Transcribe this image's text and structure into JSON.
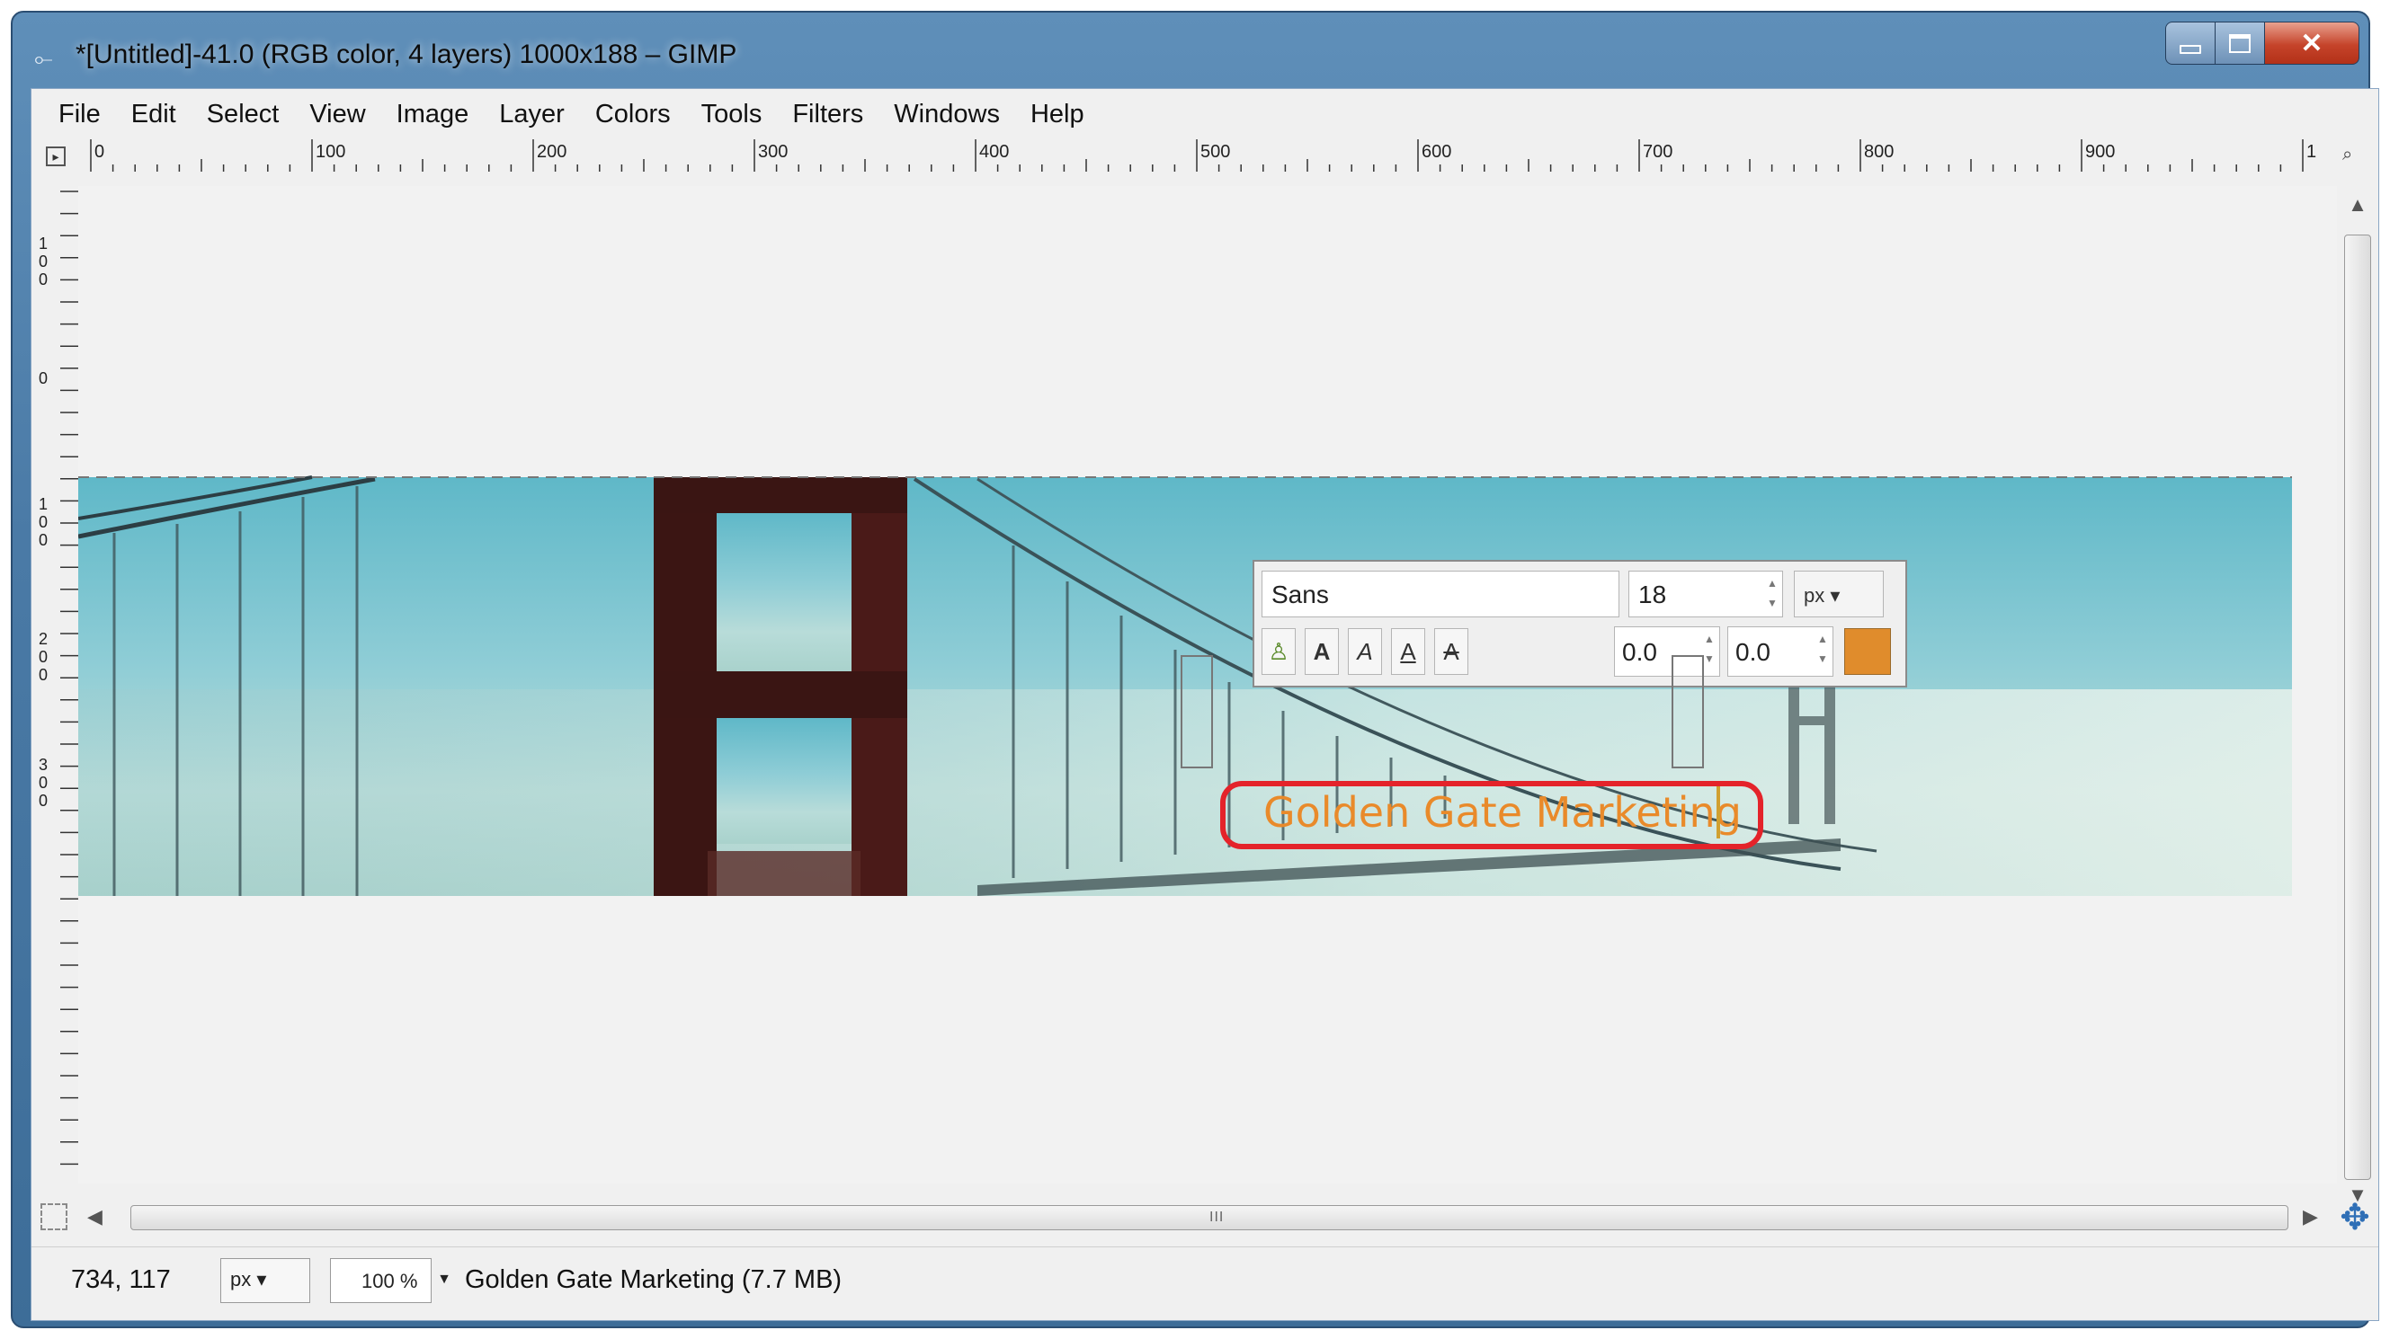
{
  "window": {
    "title": "*[Untitled]-41.0 (RGB color, 4 layers) 1000x188 – GIMP",
    "controls": {
      "minimize": "",
      "maximize": "",
      "close": "✕"
    }
  },
  "menu": [
    "File",
    "Edit",
    "Select",
    "View",
    "Image",
    "Layer",
    "Colors",
    "Tools",
    "Filters",
    "Windows",
    "Help"
  ],
  "ruler": {
    "horizontal_labels": [
      "0",
      "100",
      "200",
      "300",
      "400",
      "500",
      "600",
      "700",
      "800",
      "900",
      "1"
    ],
    "vertical_labels": [
      "1\n0\n0",
      "0",
      "1\n0\n0",
      "2\n0\n0",
      "3\n0\n0"
    ]
  },
  "text_tool": {
    "font": "Sans",
    "size": "18",
    "unit": "px",
    "style_buttons": [
      "A",
      "A",
      "A",
      "A",
      "A"
    ],
    "baseline": "0.0",
    "kerning": "0.0",
    "color": "#e08c2c"
  },
  "canvas": {
    "text_layer": "Golden Gate Marketing"
  },
  "statusbar": {
    "coords": "734, 117",
    "unit": "px",
    "zoom": "100 %",
    "message": "Golden Gate Marketing (7.7 MB)"
  },
  "scrollbar": {
    "grip": "III"
  }
}
